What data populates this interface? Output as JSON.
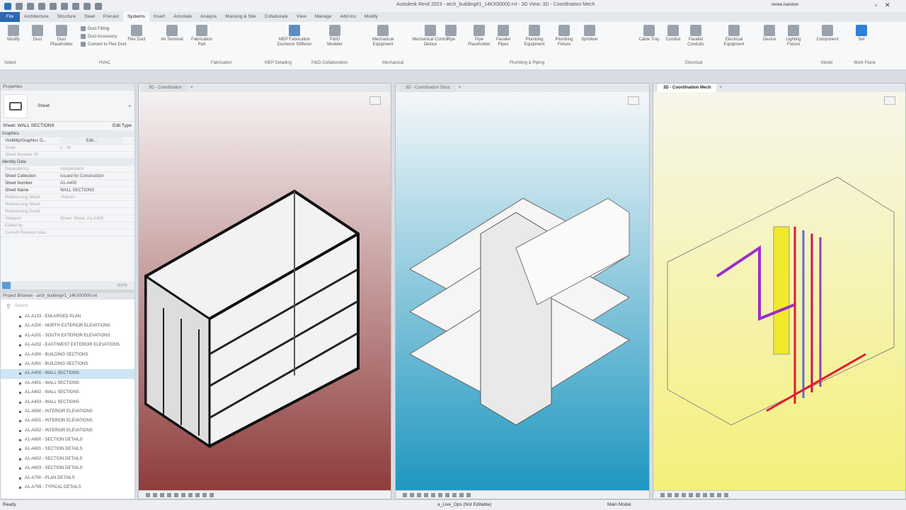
{
  "window": {
    "title": "Autodesk Revit 2023 - arch_building#1_14KX00000.rvt - 3D View: 3D - Coordination Mech",
    "user": "renee.hanston"
  },
  "ribbon_tabs": [
    "File",
    "Architecture",
    "Structure",
    "Steel",
    "Precast",
    "Systems",
    "Insert",
    "Annotate",
    "Analyze",
    "Massing & Site",
    "Collaborate",
    "View",
    "Manage",
    "Add-Ins",
    "Modify"
  ],
  "active_tab": "Systems",
  "ribbon": {
    "buttons": [
      "Modify",
      "Duct",
      "Duct Placeholder",
      "Flex Duct",
      "Air Terminal",
      "Fabrication Part",
      "MEP Fabrication Ductwork Stiffener",
      "P&ID Modeler",
      "Mechanical Equipment",
      "Mechanical Control Device",
      "Pipe",
      "Pipe Placeholder",
      "Parallel Pipes",
      "Plumbing Equipment",
      "Plumbing Fixture",
      "Sprinkler",
      "Cable Tray",
      "Conduit",
      "Parallel Conduits",
      "Electrical Equipment",
      "Device",
      "Lighting Fixture",
      "Component",
      "Set"
    ],
    "small_buttons": [
      "Duct Fitting",
      "Duct Accessory",
      "Convert to Flex Duct"
    ],
    "panels": [
      "Select",
      "HVAC",
      "Fabrication",
      "MEP Detailing",
      "P&ID Collaboration",
      "Mechanical",
      "Plumbing & Piping",
      "Electrical",
      "Model",
      "Work Plane"
    ]
  },
  "properties": {
    "title": "Properties",
    "type": "Sheet",
    "instance": "Sheet: WALL SECTIONS",
    "edit_type": "Edit Type",
    "sections": [
      {
        "name": "Graphics",
        "rows": [
          [
            "Visibility/Graphics O...",
            "Edit..."
          ],
          [
            "Scale",
            "1 : 16"
          ],
          [
            "Sheet Number Of",
            ""
          ]
        ]
      },
      {
        "name": "Identity Data",
        "rows": [
          [
            "Dependency",
            "Independent"
          ],
          [
            "Sheet Collection",
            "Issued for Construction"
          ],
          [
            "Sheet Number",
            "A1-A400"
          ],
          [
            "Sheet Name",
            "WALL SECTIONS"
          ],
          [
            "Referencing Sheet",
            "<None>"
          ],
          [
            "Referencing Sheet",
            ""
          ],
          [
            "Referencing Detail",
            ""
          ],
          [
            "Viewport",
            "Sheet: Sheet: A1-A400"
          ],
          [
            "Edited by",
            ""
          ],
          [
            "Current Revision Issu...",
            ""
          ]
        ]
      }
    ],
    "apply": "Apply"
  },
  "browser": {
    "title": "Project Browser - arch_building#1_14KX00000.rvt",
    "search_placeholder": "Search",
    "items": [
      "A1-A133 - ENLARGED PLAN",
      "A1-A200 - NORTH EXTERIOR ELEVATIONS",
      "A1-A201 - SOUTH EXTERIOR ELEVATIONS",
      "A1-A202 - EAST/WEST EXTERIOR ELEVATIONS",
      "A1-A300 - BUILDING SECTIONS",
      "A1-A301 - BUILDING SECTIONS",
      "A1-A400 - WALL SECTIONS",
      "A1-A401 - WALL SECTIONS",
      "A1-A402 - WALL SECTIONS",
      "A1-A403 - WALL SECTIONS",
      "A1-A500 - INTERIOR ELEVATIONS",
      "A1-A501 - INTERIOR ELEVATIONS",
      "A1-A502 - INTERIOR ELEVATIONS",
      "A1-A600 - SECTION DETAILS",
      "A1-A601 - SECTION DETAILS",
      "A1-A602 - SECTION DETAILS",
      "A1-A603 - SECTION DETAILS",
      "A1-A700 - PLAN DETAILS",
      "A1-A709 - TYPICAL DETAILS"
    ],
    "selected_index": 6
  },
  "views": [
    {
      "tab": "3D - Coordination",
      "background": [
        "#f6f2f2",
        "#8f3c3c"
      ]
    },
    {
      "tab": "3D - Coordination Struc",
      "background": [
        "#f4f7f9",
        "#1f97c0"
      ]
    },
    {
      "tab": "3D - Coordination Mech",
      "background": [
        "#f7f6ea",
        "#f4f07a"
      ],
      "active": true
    }
  ],
  "status": {
    "left": "Ready",
    "workset": "a_Live_Ops (Not Editable)",
    "model": "Main Model"
  },
  "colors": {
    "file_tab": "#2a68b0",
    "selection": "#cde5f5"
  }
}
